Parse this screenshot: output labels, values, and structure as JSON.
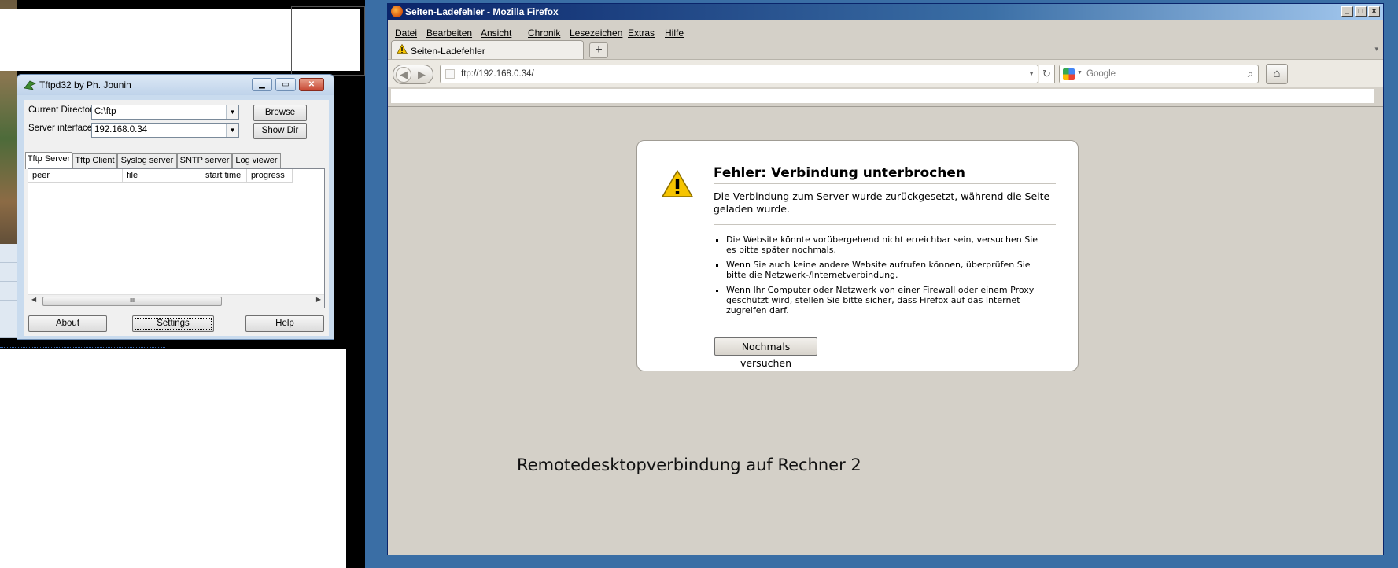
{
  "tftpd": {
    "title": "Tftpd32 by Ph. Jounin",
    "current_directory_label": "Current Directory",
    "current_directory_value": "C:\\ftp",
    "server_interface_label": "Server interface",
    "server_interface_value": "192.168.0.34",
    "browse_label": "Browse",
    "show_dir_label": "Show Dir",
    "tabs": [
      "Tftp Server",
      "Tftp Client",
      "Syslog server",
      "SNTP server",
      "Log viewer"
    ],
    "columns": [
      "peer",
      "file",
      "start time",
      "progress"
    ],
    "about_label": "About",
    "settings_label": "Settings",
    "help_label": "Help",
    "scroll_thumb": "III"
  },
  "firefox": {
    "title": "Seiten-Ladefehler - Mozilla Firefox",
    "menu": [
      "Datei",
      "Bearbeiten",
      "Ansicht",
      "Chronik",
      "Lesezeichen",
      "Extras",
      "Hilfe"
    ],
    "tab_title": "Seiten-Ladefehler",
    "url": "ftp://192.168.0.34/",
    "search_placeholder": "Google",
    "error": {
      "title": "Fehler: Verbindung unterbrochen",
      "description": "Die Verbindung zum Server wurde zurückgesetzt, während die Seite geladen wurde.",
      "items": [
        "Die Website könnte vorübergehend nicht erreichbar sein, versuchen Sie es bitte später nochmals.",
        "Wenn Sie auch keine andere Website aufrufen können, überprüfen Sie bitte die Netzwerk-/Internetverbindung.",
        "Wenn Ihr Computer oder Netzwerk von einer Firewall oder einem Proxy geschützt wird, stellen Sie bitte sicher, dass Firefox auf das Internet zugreifen darf."
      ],
      "retry_label": "Nochmals versuchen"
    },
    "caption": "Remotedesktopverbindung auf Rechner 2"
  }
}
